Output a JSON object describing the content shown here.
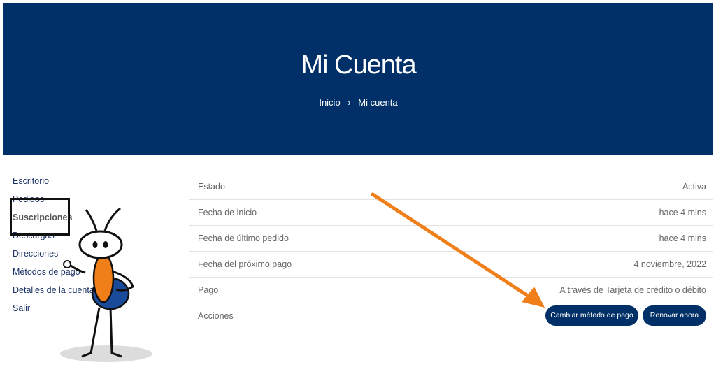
{
  "header": {
    "title": "Mi Cuenta",
    "breadcrumb": {
      "home": "Inicio",
      "separator": "›",
      "current": "Mi cuenta"
    }
  },
  "sidebar": {
    "items": [
      {
        "label": "Escritorio"
      },
      {
        "label": "Pedidos"
      },
      {
        "label": "Suscripciones",
        "active": true
      },
      {
        "label": "Descargas"
      },
      {
        "label": "Direcciones"
      },
      {
        "label": "Métodos de pago"
      },
      {
        "label": "Detalles de la cuenta"
      },
      {
        "label": "Salir"
      }
    ]
  },
  "subscription": {
    "rows": [
      {
        "label": "Estado",
        "value": "Activa"
      },
      {
        "label": "Fecha de inicio",
        "value": "hace 4 mins"
      },
      {
        "label": "Fecha de último pedido",
        "value": "hace 4 mins"
      },
      {
        "label": "Fecha del próximo pago",
        "value": "4 noviembre, 2022"
      },
      {
        "label": "Pago",
        "value": "A través de Tarjeta de crédito o débito"
      }
    ],
    "actions_label": "Acciones",
    "buttons": {
      "change_payment": "Cambiar método de pago",
      "renew_now": "Renovar ahora"
    }
  },
  "colors": {
    "brand": "#003067",
    "arrow": "#f07f1a",
    "mascot_body": "#f07f1a",
    "mascot_belly": "#1a4a9a"
  },
  "icons": [
    "breadcrumb-chevron-icon",
    "annotation-arrow-icon",
    "ant-mascot-illustration"
  ]
}
